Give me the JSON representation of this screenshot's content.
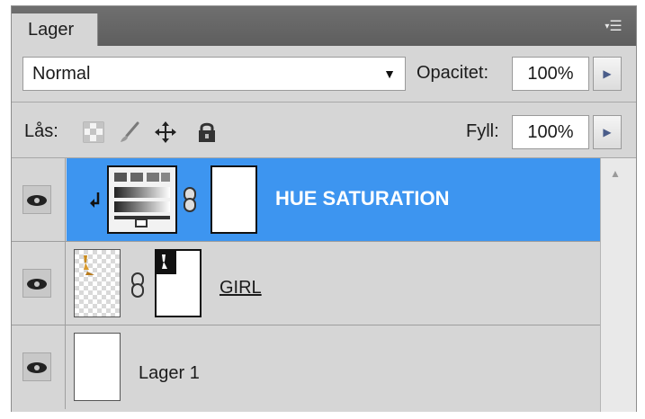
{
  "panel": {
    "tab_label": "Lager",
    "menu_icon": "panel-menu-icon"
  },
  "options": {
    "blend_mode": "Normal",
    "opacity_label": "Opacitet:",
    "opacity_value": "100%",
    "lock_label": "Lås:",
    "fill_label": "Fyll:",
    "fill_value": "100%"
  },
  "layers": [
    {
      "name": "HUE SATURATION",
      "selected": true,
      "visible": true,
      "type": "adjustment",
      "clipped": true
    },
    {
      "name": "GIRL",
      "selected": false,
      "visible": true,
      "type": "masked-image"
    },
    {
      "name": "Lager 1",
      "selected": false,
      "visible": true,
      "type": "image"
    }
  ],
  "colors": {
    "selection": "#3d95f0",
    "panel_bg": "#d6d6d6",
    "tabbar_bg": "#666666"
  }
}
